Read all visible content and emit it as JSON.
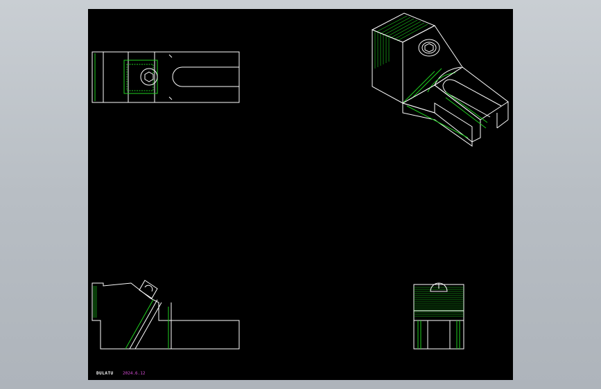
{
  "drawing": {
    "background": "#000000",
    "line_colors": {
      "visible_edges": "#ffffff",
      "hidden_and_hatch": "#1fd11f"
    },
    "views": [
      {
        "name": "top-view"
      },
      {
        "name": "isometric-view"
      },
      {
        "name": "front-view"
      },
      {
        "name": "side-view"
      }
    ]
  },
  "title_block": {
    "author": "DULATU",
    "date": "2024.6.12",
    "date_color": "#d94fd9"
  }
}
